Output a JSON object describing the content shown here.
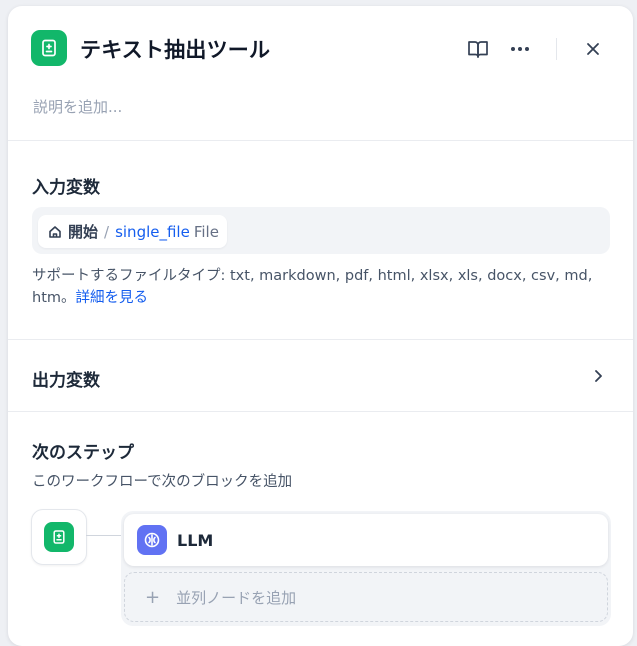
{
  "header": {
    "title": "テキスト抽出ツール",
    "description_placeholder": "説明を追加..."
  },
  "input_vars": {
    "title": "入力変数",
    "node_name": "開始",
    "separator": "/",
    "var_name": "single_file",
    "var_type": "File",
    "support_text": "サポートするファイルタイプ: txt, markdown, pdf, html, xlsx, xls, docx, csv, md, htm。",
    "learn_more": "詳細を見る"
  },
  "output_vars": {
    "title": "出力変数"
  },
  "next_step": {
    "title": "次のステップ",
    "subtitle": "このワークフローで次のブロックを追加",
    "next_node": "LLM",
    "add_parallel": "並列ノードを追加"
  },
  "colors": {
    "tool_green": "#12b76a",
    "llm_indigo": "#6172f3",
    "link_blue": "#155eef"
  },
  "icons": {
    "tool": "document-extract-icon",
    "docs": "book-open-icon",
    "more": "more-horizontal-icon",
    "close": "close-icon",
    "home": "home-icon",
    "chevron": "chevron-right-icon",
    "llm": "llm-brain-icon",
    "plus": "plus-icon"
  }
}
